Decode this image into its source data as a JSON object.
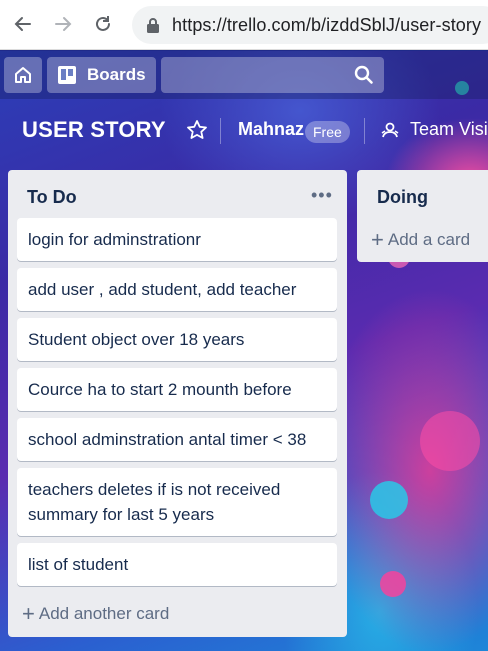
{
  "browser": {
    "url": "https://trello.com/b/izddSblJ/user-story"
  },
  "header": {
    "boards_label": "Boards"
  },
  "board": {
    "title": "USER STORY",
    "team_name": "Mahnaz",
    "plan_badge": "Free",
    "visibility_label": "Team Visib"
  },
  "lists": [
    {
      "title": "To Do",
      "cards": [
        "login for adminstrationr",
        "add user , add student, add teacher",
        "Student object over 18 years",
        "Cource ha to start 2 mounth before",
        "school adminstration antal timer < 38",
        "teachers deletes if is not received summary for last 5 years",
        "list of student"
      ],
      "add_label": "Add another card"
    },
    {
      "title": "Doing",
      "cards": [],
      "add_label": "Add a card"
    }
  ],
  "icons": [
    "back-arrow-icon",
    "forward-arrow-icon",
    "reload-icon",
    "lock-icon",
    "home-icon",
    "boards-icon",
    "search-icon",
    "star-icon",
    "team-icon",
    "more-icon",
    "plus-icon"
  ]
}
